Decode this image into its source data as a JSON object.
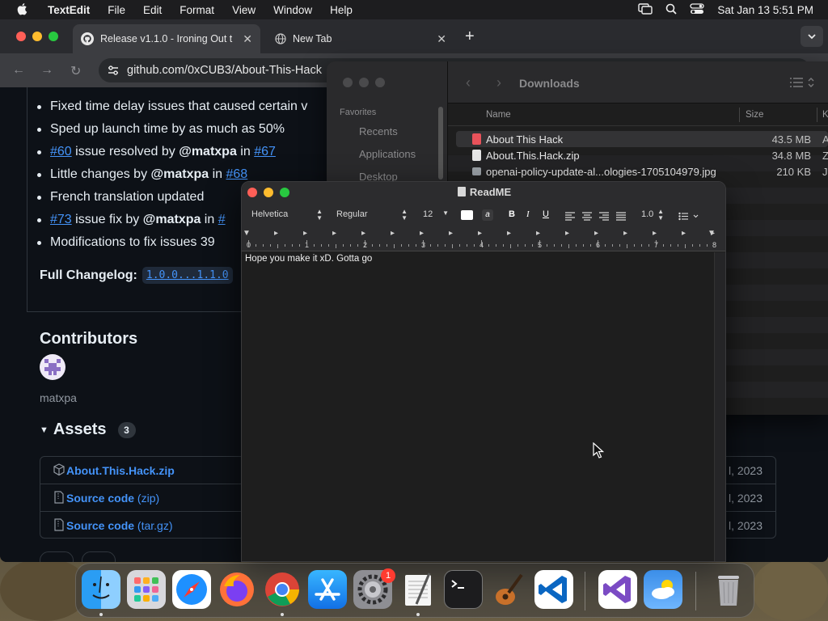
{
  "menubar": {
    "app": "TextEdit",
    "items": [
      "File",
      "Edit",
      "Format",
      "View",
      "Window",
      "Help"
    ],
    "clock": "Sat Jan 13  5:51 PM"
  },
  "browser": {
    "tabs": [
      {
        "title": "Release v1.1.0 - Ironing Out t"
      },
      {
        "title": "New Tab"
      }
    ],
    "new_tab": "+",
    "url": "github.com/0xCUB3/About-This-Hack"
  },
  "release": {
    "bullets": [
      {
        "parts": [
          {
            "t": "Fixed time delay issues that caused certain v",
            "k": "text"
          }
        ]
      },
      {
        "parts": [
          {
            "t": "Sped up launch time by as much as 50%",
            "k": "text"
          }
        ]
      },
      {
        "parts": [
          {
            "t": "#60",
            "k": "link"
          },
          {
            "t": " issue resolved by ",
            "k": "text"
          },
          {
            "t": "@matxpa",
            "k": "mention"
          },
          {
            "t": " in ",
            "k": "text"
          },
          {
            "t": "#67",
            "k": "link"
          }
        ]
      },
      {
        "parts": [
          {
            "t": "Little changes by ",
            "k": "text"
          },
          {
            "t": "@matxpa",
            "k": "mention"
          },
          {
            "t": " in ",
            "k": "text"
          },
          {
            "t": "#68",
            "k": "link"
          }
        ]
      },
      {
        "parts": [
          {
            "t": "French translation updated",
            "k": "text"
          }
        ]
      },
      {
        "parts": [
          {
            "t": "#73",
            "k": "link"
          },
          {
            "t": " issue fix by ",
            "k": "text"
          },
          {
            "t": "@matxpa",
            "k": "mention"
          },
          {
            "t": " in ",
            "k": "text"
          },
          {
            "t": "#",
            "k": "link"
          }
        ]
      },
      {
        "parts": [
          {
            "t": "Modifications to fix issues 39",
            "k": "text"
          }
        ]
      }
    ],
    "changelog_label": "Full Changelog:",
    "changelog_range": "1.0.0...1.1.0",
    "contributors_heading": "Contributors",
    "contributor": "matxpa",
    "assets_heading": "Assets",
    "assets_count": "3",
    "assets": [
      {
        "name": "About.This.Hack.zip",
        "suffix": "",
        "date": "l, 2023"
      },
      {
        "name": "Source code",
        "suffix": " (zip)",
        "date": "l, 2023"
      },
      {
        "name": "Source code",
        "suffix": " (tar.gz)",
        "date": "l, 2023"
      }
    ]
  },
  "finder": {
    "title": "Downloads",
    "sidebar_heading": "Favorites",
    "sidebar_items": [
      "Recents",
      "Applications",
      "Desktop"
    ],
    "columns": {
      "name": "Name",
      "size": "Size",
      "kind": "K"
    },
    "files": [
      {
        "name": "About This Hack",
        "size": "43.5 MB",
        "kind": "A",
        "icon_color": "#e8525a"
      },
      {
        "name": "About.This.Hack.zip",
        "size": "34.8 MB",
        "kind": "Z",
        "icon_color": "#e6e6e6"
      },
      {
        "name": "openai-policy-update-al...ologies-1705104979.jpg",
        "size": "210 KB",
        "kind": "J",
        "icon_color": "#9aa0a6"
      }
    ]
  },
  "textedit": {
    "title": "ReadME",
    "font_family": "Helvetica",
    "font_style": "Regular",
    "font_size": "12",
    "line_spacing": "1.0",
    "bold": "B",
    "italic": "I",
    "underline": "U",
    "ruler_numbers": [
      "0",
      "1",
      "2",
      "3",
      "4",
      "5",
      "6",
      "7",
      "8"
    ],
    "content": "Hope you make it xD. Gotta go"
  },
  "dock": {
    "apps": [
      "Finder",
      "Launchpad",
      "Safari",
      "Firefox",
      "Chrome",
      "App Store",
      "System Settings",
      "TextEdit",
      "Terminal",
      "GarageBand",
      "VS Code",
      "Visual Studio",
      "Weather",
      "Trash"
    ],
    "settings_badge": "1"
  }
}
